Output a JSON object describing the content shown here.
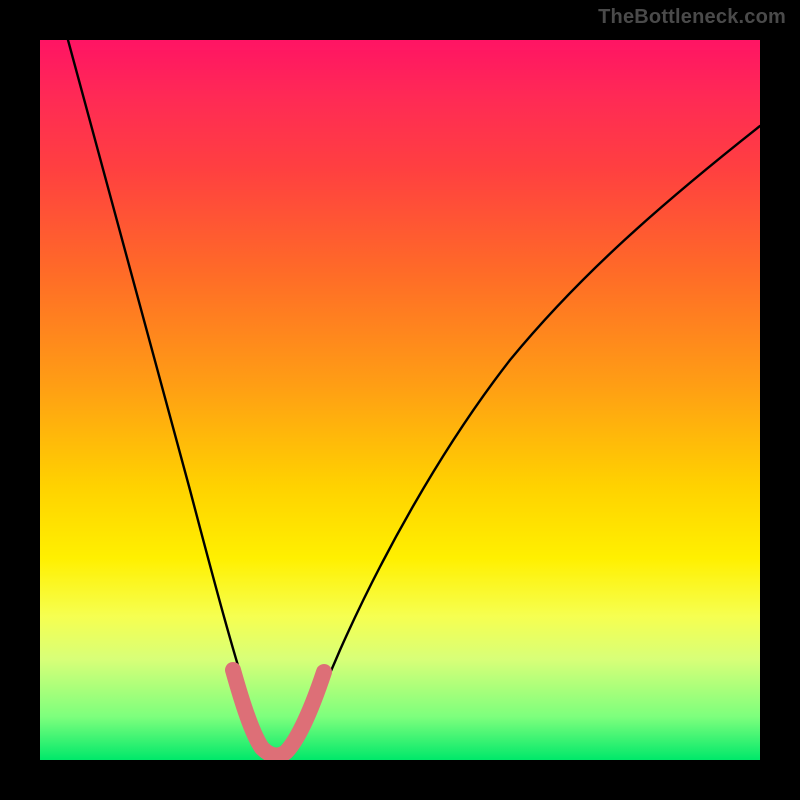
{
  "watermark": "TheBottleneck.com",
  "chart_data": {
    "type": "line",
    "title": "",
    "xlabel": "",
    "ylabel": "",
    "xlim": [
      0,
      100
    ],
    "ylim": [
      0,
      100
    ],
    "series": [
      {
        "name": "main-curve",
        "color": "#000000",
        "x": [
          4,
          8,
          12,
          16,
          20,
          24,
          26,
          28,
          30,
          32,
          34,
          36,
          40,
          46,
          54,
          64,
          76,
          88,
          100
        ],
        "y": [
          100,
          82,
          64,
          48,
          34,
          20,
          14,
          8,
          3,
          0.5,
          3,
          8,
          18,
          32,
          48,
          62,
          74,
          83,
          88
        ]
      },
      {
        "name": "highlight-band",
        "color": "#e06a6a",
        "x": [
          26,
          28,
          30,
          32,
          34,
          36
        ],
        "y": [
          14,
          8,
          3,
          0.5,
          3,
          8
        ]
      }
    ],
    "minimum_x": 32,
    "gradient_stops": [
      {
        "pos": 0,
        "color": "#ff1464"
      },
      {
        "pos": 18,
        "color": "#ff4040"
      },
      {
        "pos": 48,
        "color": "#ff9e14"
      },
      {
        "pos": 72,
        "color": "#fff000"
      },
      {
        "pos": 100,
        "color": "#00e86a"
      }
    ]
  }
}
